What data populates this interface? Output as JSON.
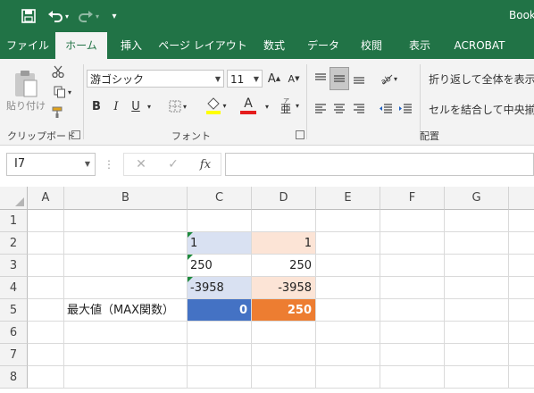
{
  "titlebar": {
    "book_title": "Book",
    "save_icon": "save-icon",
    "undo_icon": "undo-icon",
    "redo_icon": "redo-icon",
    "customize_icon": "customize-qat-icon"
  },
  "tabs": [
    {
      "label": "ファイル"
    },
    {
      "label": "ホーム"
    },
    {
      "label": "挿入"
    },
    {
      "label": "ページ レイアウト"
    },
    {
      "label": "数式"
    },
    {
      "label": "データ"
    },
    {
      "label": "校閲"
    },
    {
      "label": "表示"
    },
    {
      "label": "ACROBAT"
    }
  ],
  "ribbon": {
    "clipboard": {
      "paste_label": "貼り付け",
      "group_label": "クリップボード"
    },
    "font": {
      "font_name": "游ゴシック",
      "font_size": "11",
      "bold": "B",
      "italic": "I",
      "underline": "U",
      "group_label": "フォント"
    },
    "alignment": {
      "wrap_text": "折り返して全体を表示",
      "merge_center": "セルを結合して中央揃え",
      "group_label": "配置"
    }
  },
  "formula_bar": {
    "name_box": "I7",
    "cancel_glyph": "✕",
    "enter_glyph": "✓",
    "fx_label": "fx",
    "formula": ""
  },
  "sheet": {
    "columns": [
      "A",
      "B",
      "C",
      "D",
      "E",
      "F",
      "G"
    ],
    "rows": [
      "1",
      "2",
      "3",
      "4",
      "5",
      "6",
      "7",
      "8"
    ],
    "cells": {
      "C2": "1",
      "D2": "1",
      "C3": "250",
      "D3": "250",
      "C4": "-3958",
      "D4": "-3958",
      "B5": "最大値（MAX関数）",
      "C5": "0",
      "D5": "250"
    }
  },
  "colors": {
    "excel_green": "#217346",
    "blue_light": "#d9e1f2",
    "orange_light": "#fce4d6",
    "blue_dark": "#4472c4",
    "orange_dark": "#ed7d31"
  }
}
